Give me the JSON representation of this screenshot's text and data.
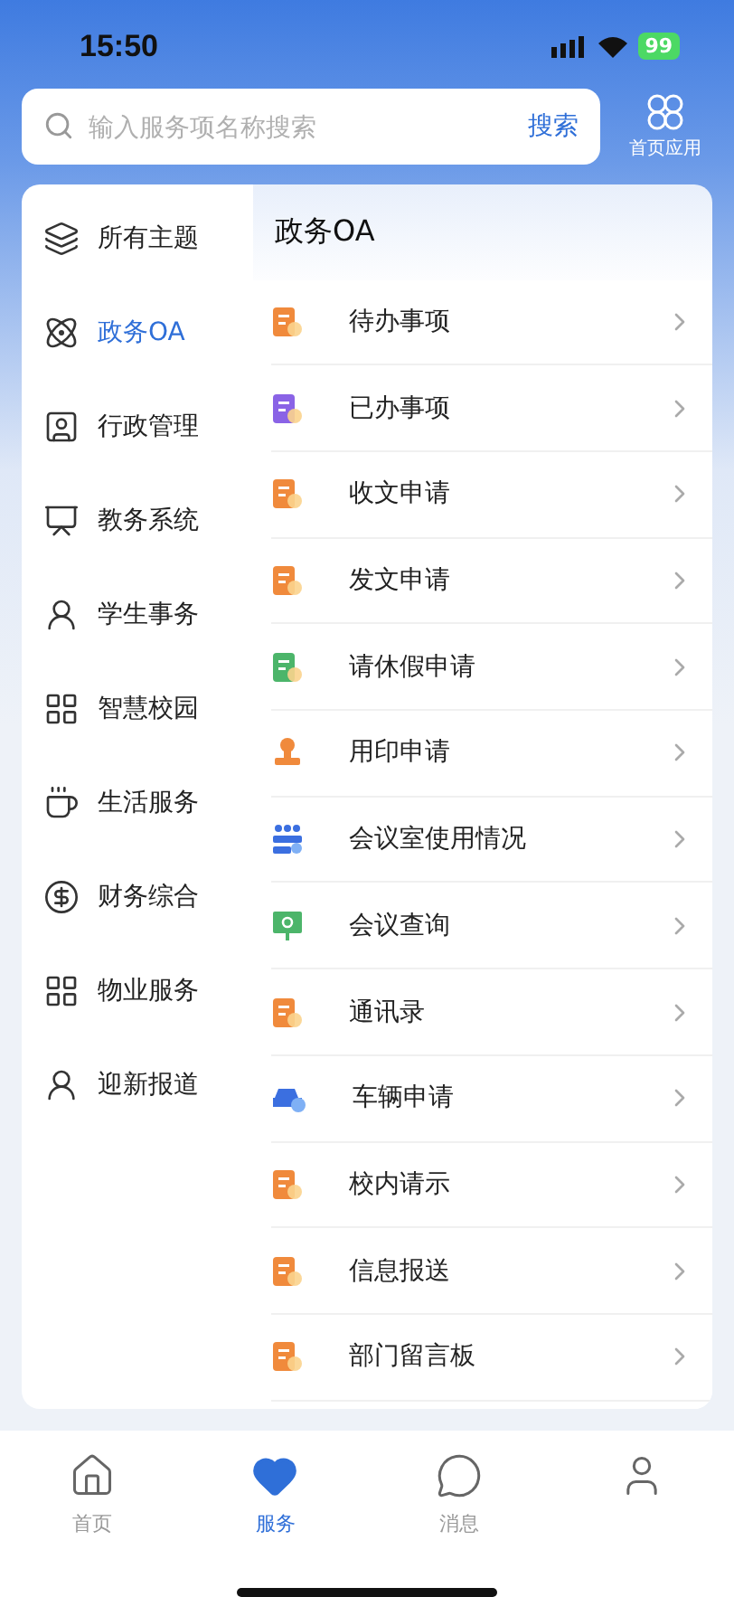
{
  "status_bar": {
    "time": "15:50",
    "battery": "99"
  },
  "search": {
    "placeholder": "输入服务项名称搜索",
    "button": "搜索"
  },
  "home_apps": {
    "label": "首页应用"
  },
  "sidebar": {
    "items": [
      {
        "label": "所有主题",
        "kind": "layers",
        "selected": false
      },
      {
        "label": "政务OA",
        "kind": "atom",
        "selected": true
      },
      {
        "label": "行政管理",
        "kind": "user-badge",
        "selected": false
      },
      {
        "label": "教务系统",
        "kind": "board",
        "selected": false
      },
      {
        "label": "学生事务",
        "kind": "user",
        "selected": false
      },
      {
        "label": "智慧校园",
        "kind": "grid",
        "selected": false
      },
      {
        "label": "生活服务",
        "kind": "cup",
        "selected": false
      },
      {
        "label": "财务综合",
        "kind": "money",
        "selected": false
      },
      {
        "label": "物业服务",
        "kind": "grid",
        "selected": false
      },
      {
        "label": "迎新报道",
        "kind": "user",
        "selected": false
      }
    ]
  },
  "section": {
    "title": "政务OA",
    "items": [
      {
        "label": "待办事项",
        "kind": "doc",
        "color": "#f08a3c"
      },
      {
        "label": "已办事项",
        "kind": "doc",
        "color": "#8a63e6"
      },
      {
        "label": "收文申请",
        "kind": "doc",
        "color": "#f08a3c"
      },
      {
        "label": "发文申请",
        "kind": "doc",
        "color": "#f08a3c"
      },
      {
        "label": "请休假申请",
        "kind": "doc",
        "color": "#4cb56a"
      },
      {
        "label": "用印申请",
        "kind": "seal",
        "color": "#f08a3c"
      },
      {
        "label": "会议室使用情况",
        "kind": "room",
        "color": "#3b6fe0"
      },
      {
        "label": "会议查询",
        "kind": "screen",
        "color": "#4cb56a"
      },
      {
        "label": "通讯录",
        "kind": "doc",
        "color": "#f08a3c"
      },
      {
        "label": "车辆申请",
        "kind": "car",
        "color": "#3b6fe0"
      },
      {
        "label": "校内请示",
        "kind": "doc",
        "color": "#f08a3c"
      },
      {
        "label": "信息报送",
        "kind": "doc",
        "color": "#f08a3c"
      },
      {
        "label": "部门留言板",
        "kind": "doc",
        "color": "#f08a3c"
      }
    ]
  },
  "tab_bar": {
    "items": [
      {
        "label": "首页",
        "kind": "home",
        "selected": false
      },
      {
        "label": "服务",
        "kind": "heart",
        "selected": true
      },
      {
        "label": "消息",
        "kind": "chat",
        "selected": false
      },
      {
        "kind": "user",
        "selected": false
      }
    ]
  }
}
